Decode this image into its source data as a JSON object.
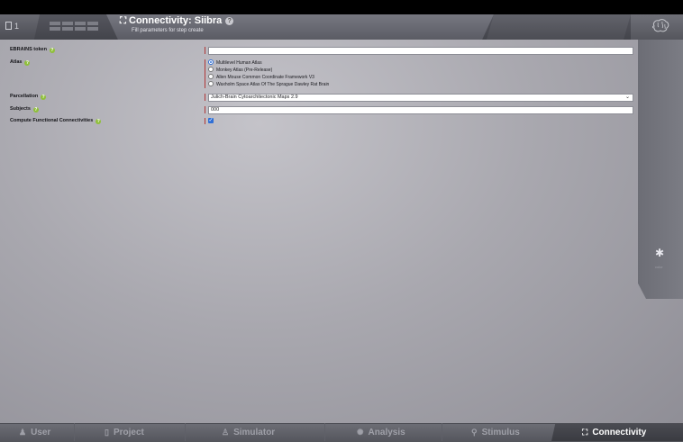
{
  "header": {
    "project_id": "1",
    "title": "Connectivity: Siibra",
    "help_symbol": "?",
    "subtitle": "Fill parameters for step create"
  },
  "form": {
    "ebrains_token": {
      "label": "EBRAINS token",
      "value": ""
    },
    "atlas": {
      "label": "Atlas",
      "options": [
        "Multilevel Human Atlas",
        "Monkey Atlas (Pre-Release)",
        "Allen Mouse Common Coordinate Framework V3",
        "Waxholm Space Atlas Of The Sprague Dawley Rat Brain"
      ],
      "selected_index": 0
    },
    "parcellation": {
      "label": "Parcellation",
      "value": "Julich-Brain Cytoarchitectonic Maps 2.9"
    },
    "subjects": {
      "label": "Subjects",
      "value": "000"
    },
    "compute_fc": {
      "label": "Compute Functional Connectivities",
      "checked": true
    }
  },
  "sidepanel": {
    "label": "color"
  },
  "nav": {
    "tabs": [
      {
        "label": "User",
        "icon": "user-icon"
      },
      {
        "label": "Project",
        "icon": "project-icon"
      },
      {
        "label": "Simulator",
        "icon": "simulator-icon"
      },
      {
        "label": "Analysis",
        "icon": "analysis-icon"
      },
      {
        "label": "Stimulus",
        "icon": "stimulus-icon"
      },
      {
        "label": "Connectivity",
        "icon": "connectivity-icon"
      }
    ],
    "active": "Connectivity"
  },
  "colors": {
    "accent": "#2f6fd6",
    "help_green": "#8fbf3a",
    "required_marker": "#b03838"
  }
}
